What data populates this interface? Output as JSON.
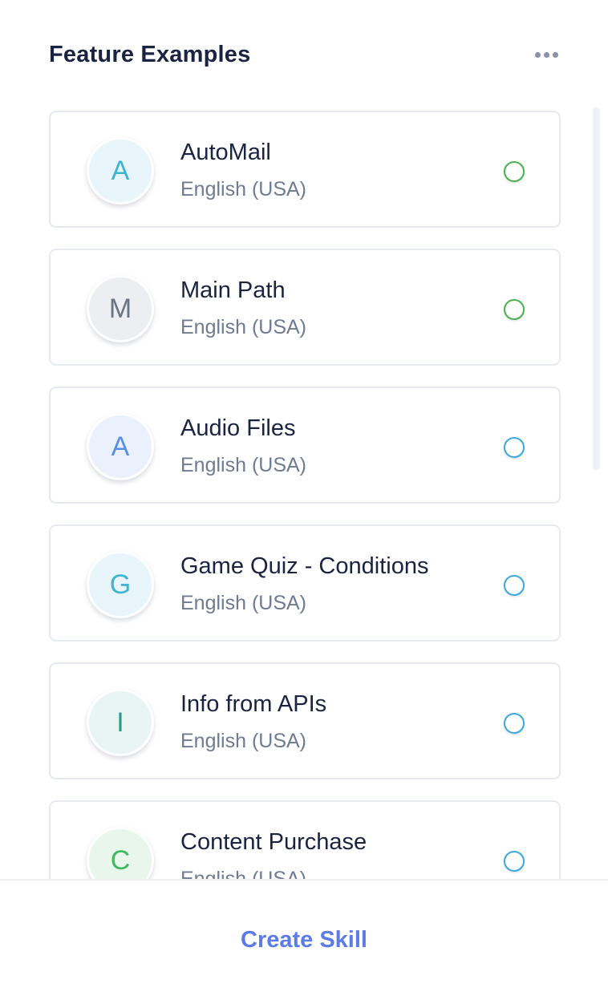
{
  "header": {
    "title": "Feature Examples",
    "more_icon": "more-horizontal-icon"
  },
  "skills": [
    {
      "initial": "A",
      "name": "AutoMail",
      "language": "English (USA)",
      "avatar_bg": "#e8f5fa",
      "avatar_fg": "#3fb4cf",
      "status_color": "#4caf50"
    },
    {
      "initial": "M",
      "name": "Main Path",
      "language": "English (USA)",
      "avatar_bg": "#eceef1",
      "avatar_fg": "#6b7486",
      "status_color": "#4caf50"
    },
    {
      "initial": "A",
      "name": "Audio Files",
      "language": "English (USA)",
      "avatar_bg": "#ebf1fc",
      "avatar_fg": "#5a8ee8",
      "status_color": "#3aa9dc"
    },
    {
      "initial": "G",
      "name": "Game Quiz - Conditions",
      "language": "English (USA)",
      "avatar_bg": "#e8f5fa",
      "avatar_fg": "#3fb4cf",
      "status_color": "#3aa9dc"
    },
    {
      "initial": "I",
      "name": "Info from APIs",
      "language": "English (USA)",
      "avatar_bg": "#e9f5f3",
      "avatar_fg": "#2a9d8f",
      "status_color": "#3aa9dc"
    },
    {
      "initial": "C",
      "name": "Content Purchase",
      "language": "English (USA)",
      "avatar_bg": "#e8f6ec",
      "avatar_fg": "#3fb85f",
      "status_color": "#3aa9dc"
    }
  ],
  "footer": {
    "create_label": "Create Skill"
  },
  "colors": {
    "accent": "#5b7be6",
    "title": "#1a2340",
    "subtext": "#6f7b92"
  }
}
